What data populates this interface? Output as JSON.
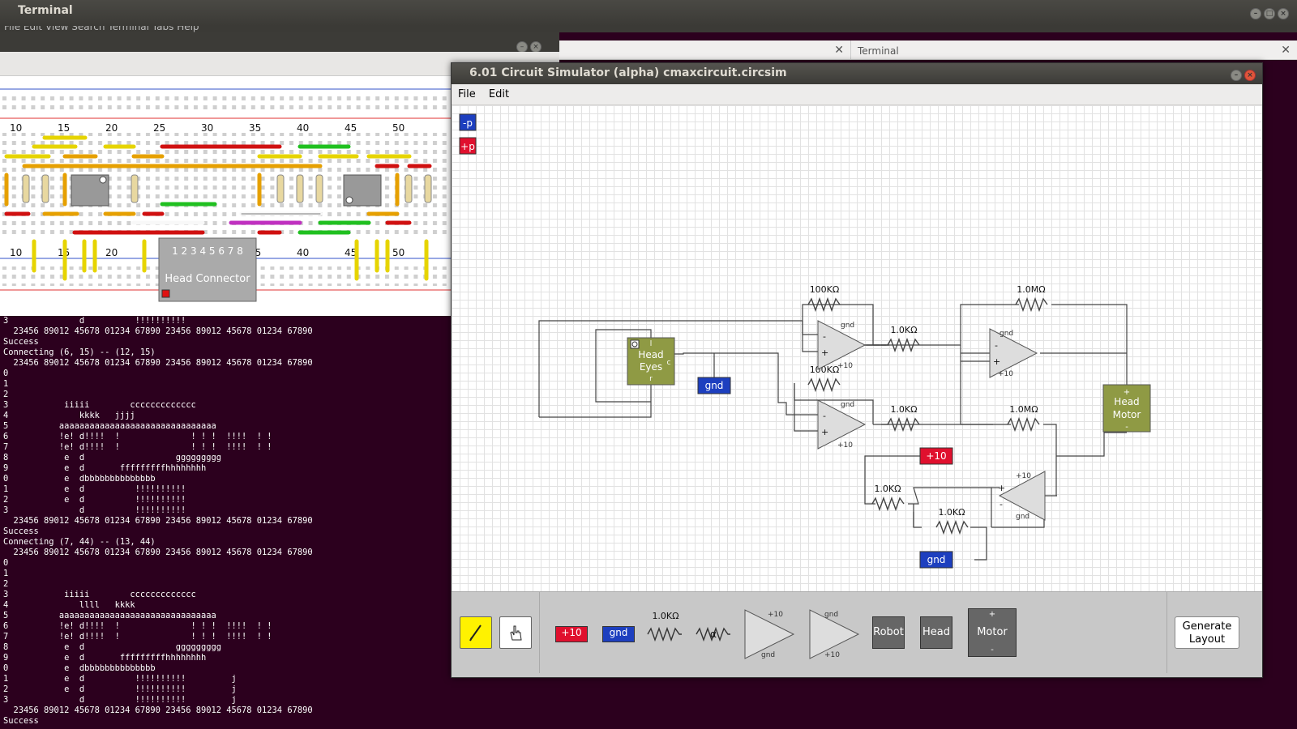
{
  "desktop": {
    "back_terminal_title": "Terminal",
    "back_terminal_menu": "File  Edit  View  Search  Terminal  Tabs  Help"
  },
  "breadboard": {
    "top_row_numbers": [
      "10",
      "15",
      "20",
      "25",
      "30",
      "35",
      "40",
      "45",
      "50"
    ],
    "bottom_row_numbers": [
      "10",
      "15",
      "20",
      "35",
      "40",
      "45",
      "50"
    ],
    "head_connector_label": "Head Connector",
    "head_connector_pins": "1 2 3 4 5 6 7 8"
  },
  "tabs": [
    {
      "label": ""
    },
    {
      "label": "Terminal"
    }
  ],
  "terminal_lines": [
    "3              d          !!!!!!!!!!",
    "  23456 89012 45678 01234 67890 23456 89012 45678 01234 67890",
    "Success",
    "Connecting (6, 15) -- (12, 15)",
    "  23456 89012 45678 01234 67890 23456 89012 45678 01234 67890",
    "0",
    "1",
    "2",
    "3           iiiii        ccccccccccccc",
    "4              kkkk   jjjj",
    "5          aaaaaaaaaaaaaaaaaaaaaaaaaaaaaaa",
    "6          !e! d!!!!  !              ! ! !  !!!!  ! !",
    "7          !e! d!!!!  !              ! ! !  !!!!  ! !",
    "8           e  d                  ggggggggg",
    "9           e  d       fffffffffhhhhhhhh",
    "0           e  dbbbbbbbbbbbbbb",
    "1           e  d          !!!!!!!!!!",
    "2           e  d          !!!!!!!!!!",
    "3              d          !!!!!!!!!!",
    "  23456 89012 45678 01234 67890 23456 89012 45678 01234 67890",
    "Success",
    "Connecting (7, 44) -- (13, 44)",
    "  23456 89012 45678 01234 67890 23456 89012 45678 01234 67890",
    "0",
    "1",
    "2",
    "3           iiiii        ccccccccccccc",
    "4              llll   kkkk",
    "5          aaaaaaaaaaaaaaaaaaaaaaaaaaaaaaa",
    "6          !e! d!!!!  !              ! ! !  !!!!  ! !",
    "7          !e! d!!!!  !              ! ! !  !!!!  ! !",
    "8           e  d                  ggggggggg",
    "9           e  d       fffffffffhhhhhhhh",
    "0           e  dbbbbbbbbbbbbbb",
    "1           e  d          !!!!!!!!!!         j",
    "2           e  d          !!!!!!!!!!         j",
    "3              d          !!!!!!!!!!         j",
    "  23456 89012 45678 01234 67890 23456 89012 45678 01234 67890",
    "Success"
  ],
  "simulator": {
    "title": "6.01 Circuit Simulator (alpha) cmaxcircuit.circsim",
    "menu": [
      "File",
      "Edit"
    ],
    "probes": {
      "minus": "-p",
      "plus": "+p"
    },
    "resistors": {
      "r100k_top": "100KΩ",
      "r100k_mid": "100KΩ",
      "r1k_a": "1.0KΩ",
      "r1k_b": "1.0KΩ",
      "r1m_top": "1.0MΩ",
      "r1m_mid": "1.0MΩ",
      "r1k_c": "1.0KΩ",
      "r1k_d": "1.0KΩ"
    },
    "opamp_labels": {
      "gnd": "gnd",
      "plus10": "+10",
      "minus": "-",
      "plus": "+"
    },
    "head_eyes": {
      "line1": "Head",
      "line2": "Eyes",
      "pin_l": "l",
      "pin_c": "c",
      "pin_r": "r"
    },
    "head_motor": {
      "line1": "Head",
      "line2": "Motor",
      "plus": "+",
      "minus": "-"
    },
    "supply_tags": {
      "gnd1": "gnd",
      "gnd2": "gnd",
      "plus10": "+10"
    },
    "palette": {
      "plus10": "+10",
      "gnd": "gnd",
      "resistor": "1.0KΩ",
      "pot_alpha": "α",
      "opamp1_top": "+10",
      "opamp1_bottom": "gnd",
      "opamp2_top": "gnd",
      "opamp2_bottom": "+10",
      "robot": "Robot",
      "head": "Head",
      "motor": "Motor",
      "motor_plus": "+",
      "motor_minus": "-",
      "generate_line1": "Generate",
      "generate_line2": "Layout"
    }
  }
}
